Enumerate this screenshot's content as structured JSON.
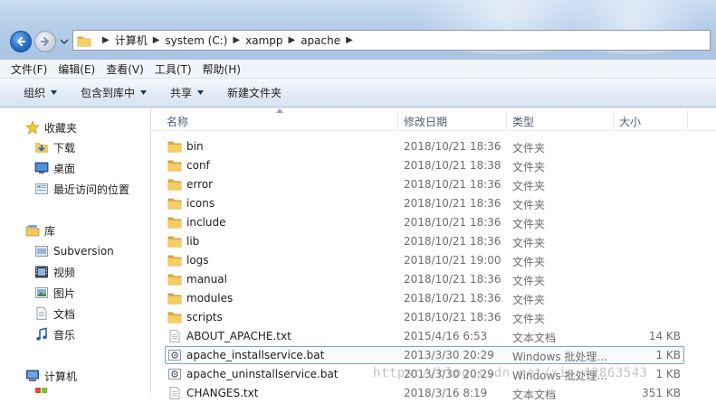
{
  "address": {
    "crumbs": [
      "计算机",
      "system (C:)",
      "xampp",
      "apache"
    ]
  },
  "menu": [
    "文件(F)",
    "编辑(E)",
    "查看(V)",
    "工具(T)",
    "帮助(H)"
  ],
  "toolbar": {
    "organize": "组织",
    "include_in_library": "包含到库中",
    "share": "共享",
    "new_folder": "新建文件夹"
  },
  "nav": {
    "favorites": "收藏夹",
    "downloads": "下载",
    "desktop": "桌面",
    "recent": "最近访问的位置",
    "libraries": "库",
    "subversion": "Subversion",
    "videos": "视频",
    "pictures": "图片",
    "documents": "文档",
    "music": "音乐",
    "computer": "计算机"
  },
  "columns": {
    "name": "名称",
    "date": "修改日期",
    "type": "类型",
    "size": "大小"
  },
  "files": [
    {
      "name": "bin",
      "date": "2018/10/21 18:36",
      "type": "文件夹",
      "size": "",
      "icon": "folder-icon"
    },
    {
      "name": "conf",
      "date": "2018/10/21 18:38",
      "type": "文件夹",
      "size": "",
      "icon": "folder-icon"
    },
    {
      "name": "error",
      "date": "2018/10/21 18:36",
      "type": "文件夹",
      "size": "",
      "icon": "folder-icon"
    },
    {
      "name": "icons",
      "date": "2018/10/21 18:36",
      "type": "文件夹",
      "size": "",
      "icon": "folder-icon"
    },
    {
      "name": "include",
      "date": "2018/10/21 18:36",
      "type": "文件夹",
      "size": "",
      "icon": "folder-icon"
    },
    {
      "name": "lib",
      "date": "2018/10/21 18:36",
      "type": "文件夹",
      "size": "",
      "icon": "folder-icon"
    },
    {
      "name": "logs",
      "date": "2018/10/21 19:00",
      "type": "文件夹",
      "size": "",
      "icon": "folder-icon"
    },
    {
      "name": "manual",
      "date": "2018/10/21 18:36",
      "type": "文件夹",
      "size": "",
      "icon": "folder-icon"
    },
    {
      "name": "modules",
      "date": "2018/10/21 18:36",
      "type": "文件夹",
      "size": "",
      "icon": "folder-icon"
    },
    {
      "name": "scripts",
      "date": "2018/10/21 18:36",
      "type": "文件夹",
      "size": "",
      "icon": "folder-icon"
    },
    {
      "name": "ABOUT_APACHE.txt",
      "date": "2015/4/16 6:53",
      "type": "文本文档",
      "size": "14 KB",
      "icon": "text-file-icon"
    },
    {
      "name": "apache_installservice.bat",
      "date": "2013/3/30 20:29",
      "type": "Windows 批处理...",
      "size": "1 KB",
      "icon": "batch-file-icon"
    },
    {
      "name": "apache_uninstallservice.bat",
      "date": "2013/3/30 20:29",
      "type": "Windows 批处理...",
      "size": "1 KB",
      "icon": "batch-file-icon"
    },
    {
      "name": "CHANGES.txt",
      "date": "2018/3/16 8:19",
      "type": "文本文档",
      "size": "351 KB",
      "icon": "text-file-icon"
    }
  ],
  "selected_index": 11,
  "watermark": "https://blog.csdn.net/xin_42863543"
}
